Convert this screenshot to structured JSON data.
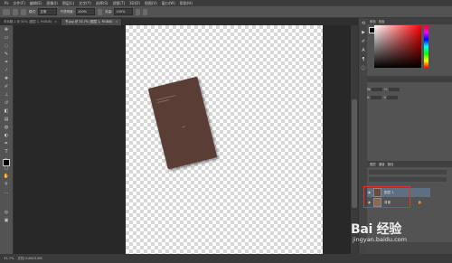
{
  "menubar": {
    "items": [
      "Ps",
      "文件(F)",
      "编辑(E)",
      "图像(I)",
      "图层(L)",
      "文字(Y)",
      "选择(S)",
      "滤镜(T)",
      "3D(D)",
      "视图(V)",
      "窗口(W)",
      "帮助(H)"
    ]
  },
  "options": {
    "mode_label": "模式:",
    "mode_value": "正常",
    "opacity_label": "不透明度:",
    "opacity_value": "100%",
    "flow_label": "流量:",
    "flow_value": "100%"
  },
  "tabs": [
    {
      "label": "未标题-1 @ 50% (图层 1, RGB/8)",
      "active": false
    },
    {
      "label": "书.jpg @ 33.7% (图层 1, RGB/8)",
      "active": true
    }
  ],
  "panels": {
    "color_tabs": [
      "颜色",
      "色板"
    ],
    "props_rows": [
      {
        "label1": "W:",
        "label2": "H:"
      },
      {
        "label1": "X:",
        "label2": "Y:"
      }
    ]
  },
  "layers": {
    "tabs": [
      "图层",
      "通道",
      "路径"
    ],
    "rows": [
      {
        "name": "图层 1",
        "selected": true
      },
      {
        "name": "背景",
        "selected": false
      }
    ]
  },
  "statusbar": {
    "zoom": "33.7%",
    "doc": "文档:3.8M/3.8M"
  },
  "watermark": {
    "logo": "Bai 经验",
    "url": "jingyan.baidu.com"
  },
  "colors": {
    "book": "#5a3d35",
    "highlight": "#e0332b"
  }
}
